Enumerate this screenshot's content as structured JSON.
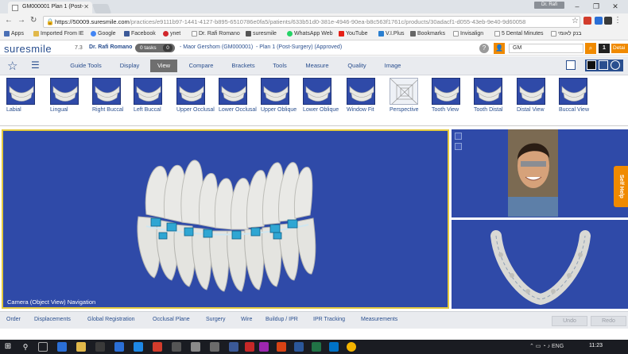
{
  "browser": {
    "tab_title": "GM000001 Plan 1 (Post-",
    "profile_label": "Dr. Rafi",
    "url_host": "https://50009.suresmile.com",
    "url_path": "/practices/e9111b97-1441-4127-b895-6510786e0fa5/patients/633b51d0-381e-4946-90ea-b8c563f1761c/products/30adacf1-d055-43eb-9e40-9d60058",
    "bookmarks": [
      "Apps",
      "Imported From IE",
      "Google",
      "Facebook",
      "ynet",
      "Dr. Rafi Romano",
      "suresmile",
      "WhatsApp Web",
      "YouTube",
      "V.I.Plus",
      "Bookmarks",
      "Invisalign",
      "5 Dental Minutes",
      "בנק לאומי"
    ]
  },
  "header": {
    "logo": "suresmile",
    "version": "7.3",
    "doctor": "Dr. Rafi Romano",
    "tasks_label": "0 tasks",
    "tasks_count": "0",
    "patient": "Maor Gershom (GM000001)",
    "plan": "Plan 1 (Post-Surgery) (Approved)",
    "search_value": "GM",
    "page_number": "1",
    "details_label": "Detai"
  },
  "menu": {
    "tabs": [
      "Guide Tools",
      "Display",
      "View",
      "Compare",
      "Brackets",
      "Tools",
      "Measure",
      "Quality",
      "Image"
    ],
    "active": "View"
  },
  "toolbar": {
    "tools": [
      {
        "label": "Labial"
      },
      {
        "label": "Lingual"
      },
      {
        "label": "Right Buccal"
      },
      {
        "label": "Left Buccal"
      },
      {
        "label": "Upper Occlusal"
      },
      {
        "label": "Lower Occlusal"
      },
      {
        "label": "Upper Oblique"
      },
      {
        "label": "Lower Oblique"
      },
      {
        "label": "Window Fit"
      },
      {
        "label": "Perspective"
      },
      {
        "label": "Tooth View"
      },
      {
        "label": "Tooth Distal"
      },
      {
        "label": "Distal View"
      },
      {
        "label": "Buccal View"
      }
    ]
  },
  "viewport": {
    "nav_label": "Camera (Object View) Navigation",
    "self_help": "Self Help"
  },
  "bottom": {
    "tabs": [
      "Order",
      "Displacements",
      "Global Registration",
      "Occlusal Plane",
      "Surgery",
      "Wire",
      "Buildup / IPR",
      "IPR Tracking",
      "Measurements"
    ],
    "undo": "Undo",
    "redo": "Redo"
  },
  "taskbar": {
    "language": "ENG",
    "time": "11:23"
  },
  "colors": {
    "viewport_bg": "#2f4aa8",
    "accent": "#f08a00",
    "brand": "#2a4f8f",
    "selection_border": "#e3c93f"
  }
}
